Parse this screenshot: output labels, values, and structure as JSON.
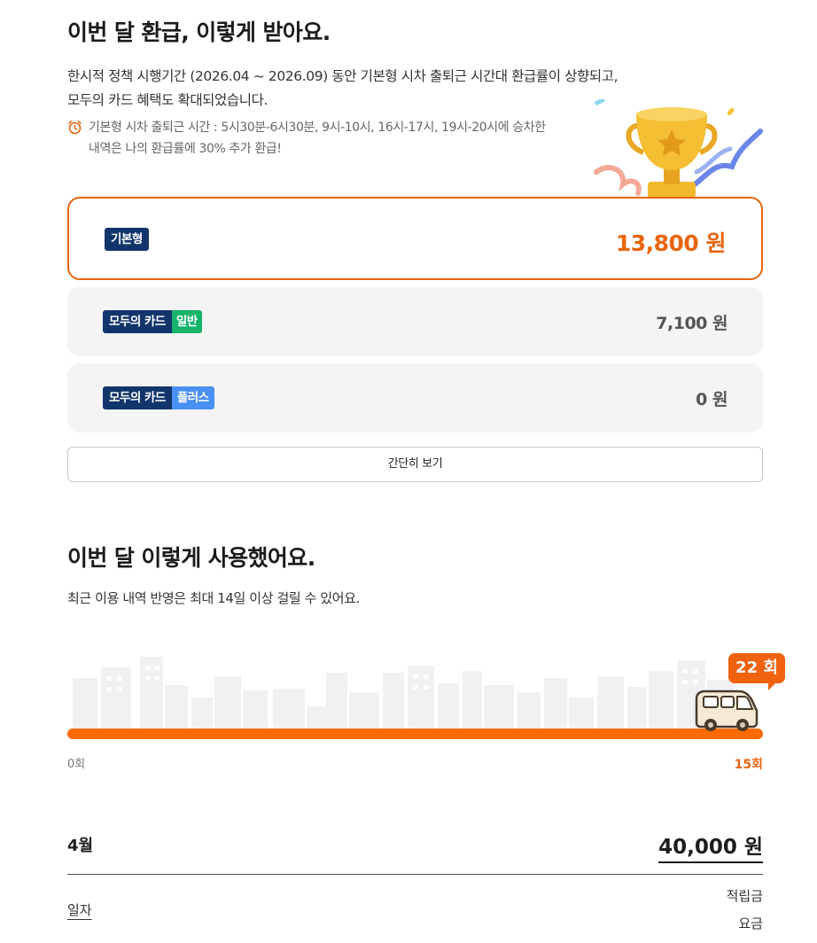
{
  "refund_section": {
    "title": "이번 달 환급, 이렇게 받아요.",
    "desc_line1": "한시적 정책 시행기간 (2026.04 ~ 2026.09) 동안 기본형 시차 출퇴근 시간대 환급률이 상향되고,",
    "desc_line2": "모두의 카드 혜택도 확대되었습니다.",
    "note_line1": "기본형 시차 출퇴근 시간 : 5시30분-6시30분, 9시-10시, 16시-17시, 19시-20시에 승차한",
    "note_line2": "내역은 나의 환급률에 30% 추가 환급!",
    "cards": [
      {
        "badge": "기본형",
        "amount": "13,800 원"
      },
      {
        "badge": "모두의 카드",
        "badge_tag": "일반",
        "amount": "7,100 원"
      },
      {
        "badge": "모두의 카드",
        "badge_tag": "플러스",
        "amount": "0 원"
      }
    ],
    "simple_view_button": "간단히 보기"
  },
  "usage_section": {
    "title": "이번 달 이렇게 사용했어요.",
    "desc": "최근 이용 내역 반영은 최대 14일 이상 걸릴 수 있어요.",
    "count_bubble": "22 회",
    "progress_fraction": 1.0,
    "scale_min": "0회",
    "scale_max": "15회"
  },
  "summary": {
    "month": "4월",
    "total": "40,000 원",
    "col_date": "일자",
    "col_accum": "적립금",
    "col_fare": "요금"
  },
  "colors": {
    "accent": "#f0620f",
    "navy": "#12356b",
    "green": "#14b36a",
    "blue": "#4a8ff2"
  }
}
